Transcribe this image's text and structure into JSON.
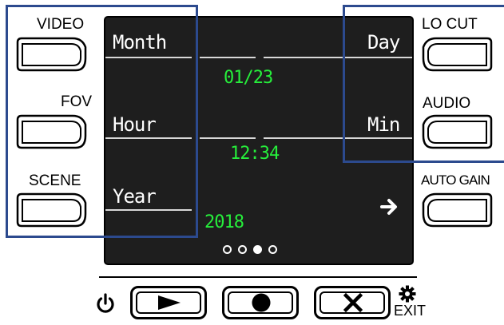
{
  "left_buttons": [
    {
      "label": "VIDEO"
    },
    {
      "label": "FOV"
    },
    {
      "label": "SCENE"
    }
  ],
  "right_buttons": [
    {
      "label": "LO CUT"
    },
    {
      "label": "AUDIO"
    },
    {
      "label": "AUTO GAIN"
    }
  ],
  "screen": {
    "month_label": "Month",
    "day_label": "Day",
    "date_value": "01/23",
    "hour_label": "Hour",
    "min_label": "Min",
    "time_value": "12:34",
    "year_label": "Year",
    "year_value": "2018",
    "next_icon": "right-arrow",
    "page_dots": {
      "total": 4,
      "active": 3
    }
  },
  "bottom": {
    "exit_label": "EXIT",
    "icons": [
      "power-icon",
      "play-icon",
      "record-icon",
      "close-icon",
      "gear-icon"
    ]
  },
  "colors": {
    "screen_bg": "#1e1e1e",
    "value_text": "#26ee3b",
    "highlight_frame": "#2c4a8e"
  }
}
